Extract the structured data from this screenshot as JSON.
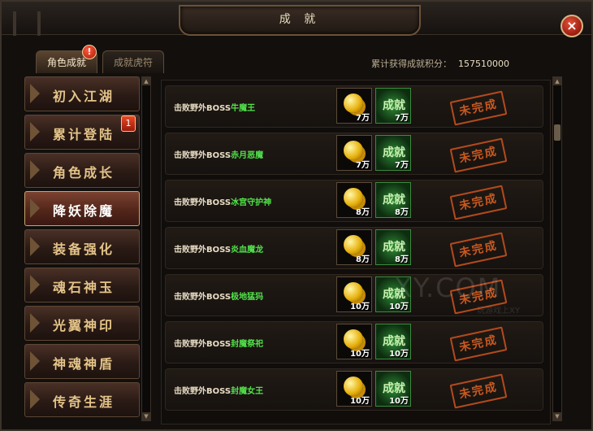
{
  "window": {
    "title": "成 就",
    "close_label": "×"
  },
  "tabs": [
    {
      "label": "角色成就",
      "active": true,
      "alert": "!"
    },
    {
      "label": "成就虎符",
      "active": false
    }
  ],
  "score": {
    "label": "累计获得成就积分：",
    "value": "157510000"
  },
  "categories": [
    {
      "label": "初入江湖"
    },
    {
      "label": "累计登陆",
      "badge": "1"
    },
    {
      "label": "角色成长"
    },
    {
      "label": "降妖除魔",
      "selected": true
    },
    {
      "label": "装备强化"
    },
    {
      "label": "魂石神玉"
    },
    {
      "label": "光翼神印"
    },
    {
      "label": "神魂神盾"
    },
    {
      "label": "传奇生涯"
    }
  ],
  "achievements": [
    {
      "prefix": "击败野外BOSS",
      "boss": "牛魔王",
      "coin_amount": "7万",
      "ach_label": "成就",
      "ach_amount": "7万",
      "status": "未完成"
    },
    {
      "prefix": "击败野外BOSS",
      "boss": "赤月恶魔",
      "coin_amount": "7万",
      "ach_label": "成就",
      "ach_amount": "7万",
      "status": "未完成"
    },
    {
      "prefix": "击败野外BOSS",
      "boss": "冰宫守护神",
      "coin_amount": "8万",
      "ach_label": "成就",
      "ach_amount": "8万",
      "status": "未完成"
    },
    {
      "prefix": "击败野外BOSS",
      "boss": "炎血魔龙",
      "coin_amount": "8万",
      "ach_label": "成就",
      "ach_amount": "8万",
      "status": "未完成"
    },
    {
      "prefix": "击败野外BOSS",
      "boss": "极地猛犸",
      "coin_amount": "10万",
      "ach_label": "成就",
      "ach_amount": "10万",
      "status": "未完成"
    },
    {
      "prefix": "击败野外BOSS",
      "boss": "封魔祭祀",
      "coin_amount": "10万",
      "ach_label": "成就",
      "ach_amount": "10万",
      "status": "未完成"
    },
    {
      "prefix": "击败野外BOSS",
      "boss": "封魔女王",
      "coin_amount": "10万",
      "ach_label": "成就",
      "ach_amount": "10万",
      "status": "未完成"
    }
  ],
  "watermark": {
    "main": "XY.COM",
    "sub": "玩游戏上XY"
  },
  "colors": {
    "boss_name": "#51e34a",
    "stamp": "#c9581f",
    "category_text": "#e4c489"
  },
  "icons": {
    "close": "close-icon",
    "coin": "gold-coin-icon",
    "achievement": "achievement-icon"
  }
}
